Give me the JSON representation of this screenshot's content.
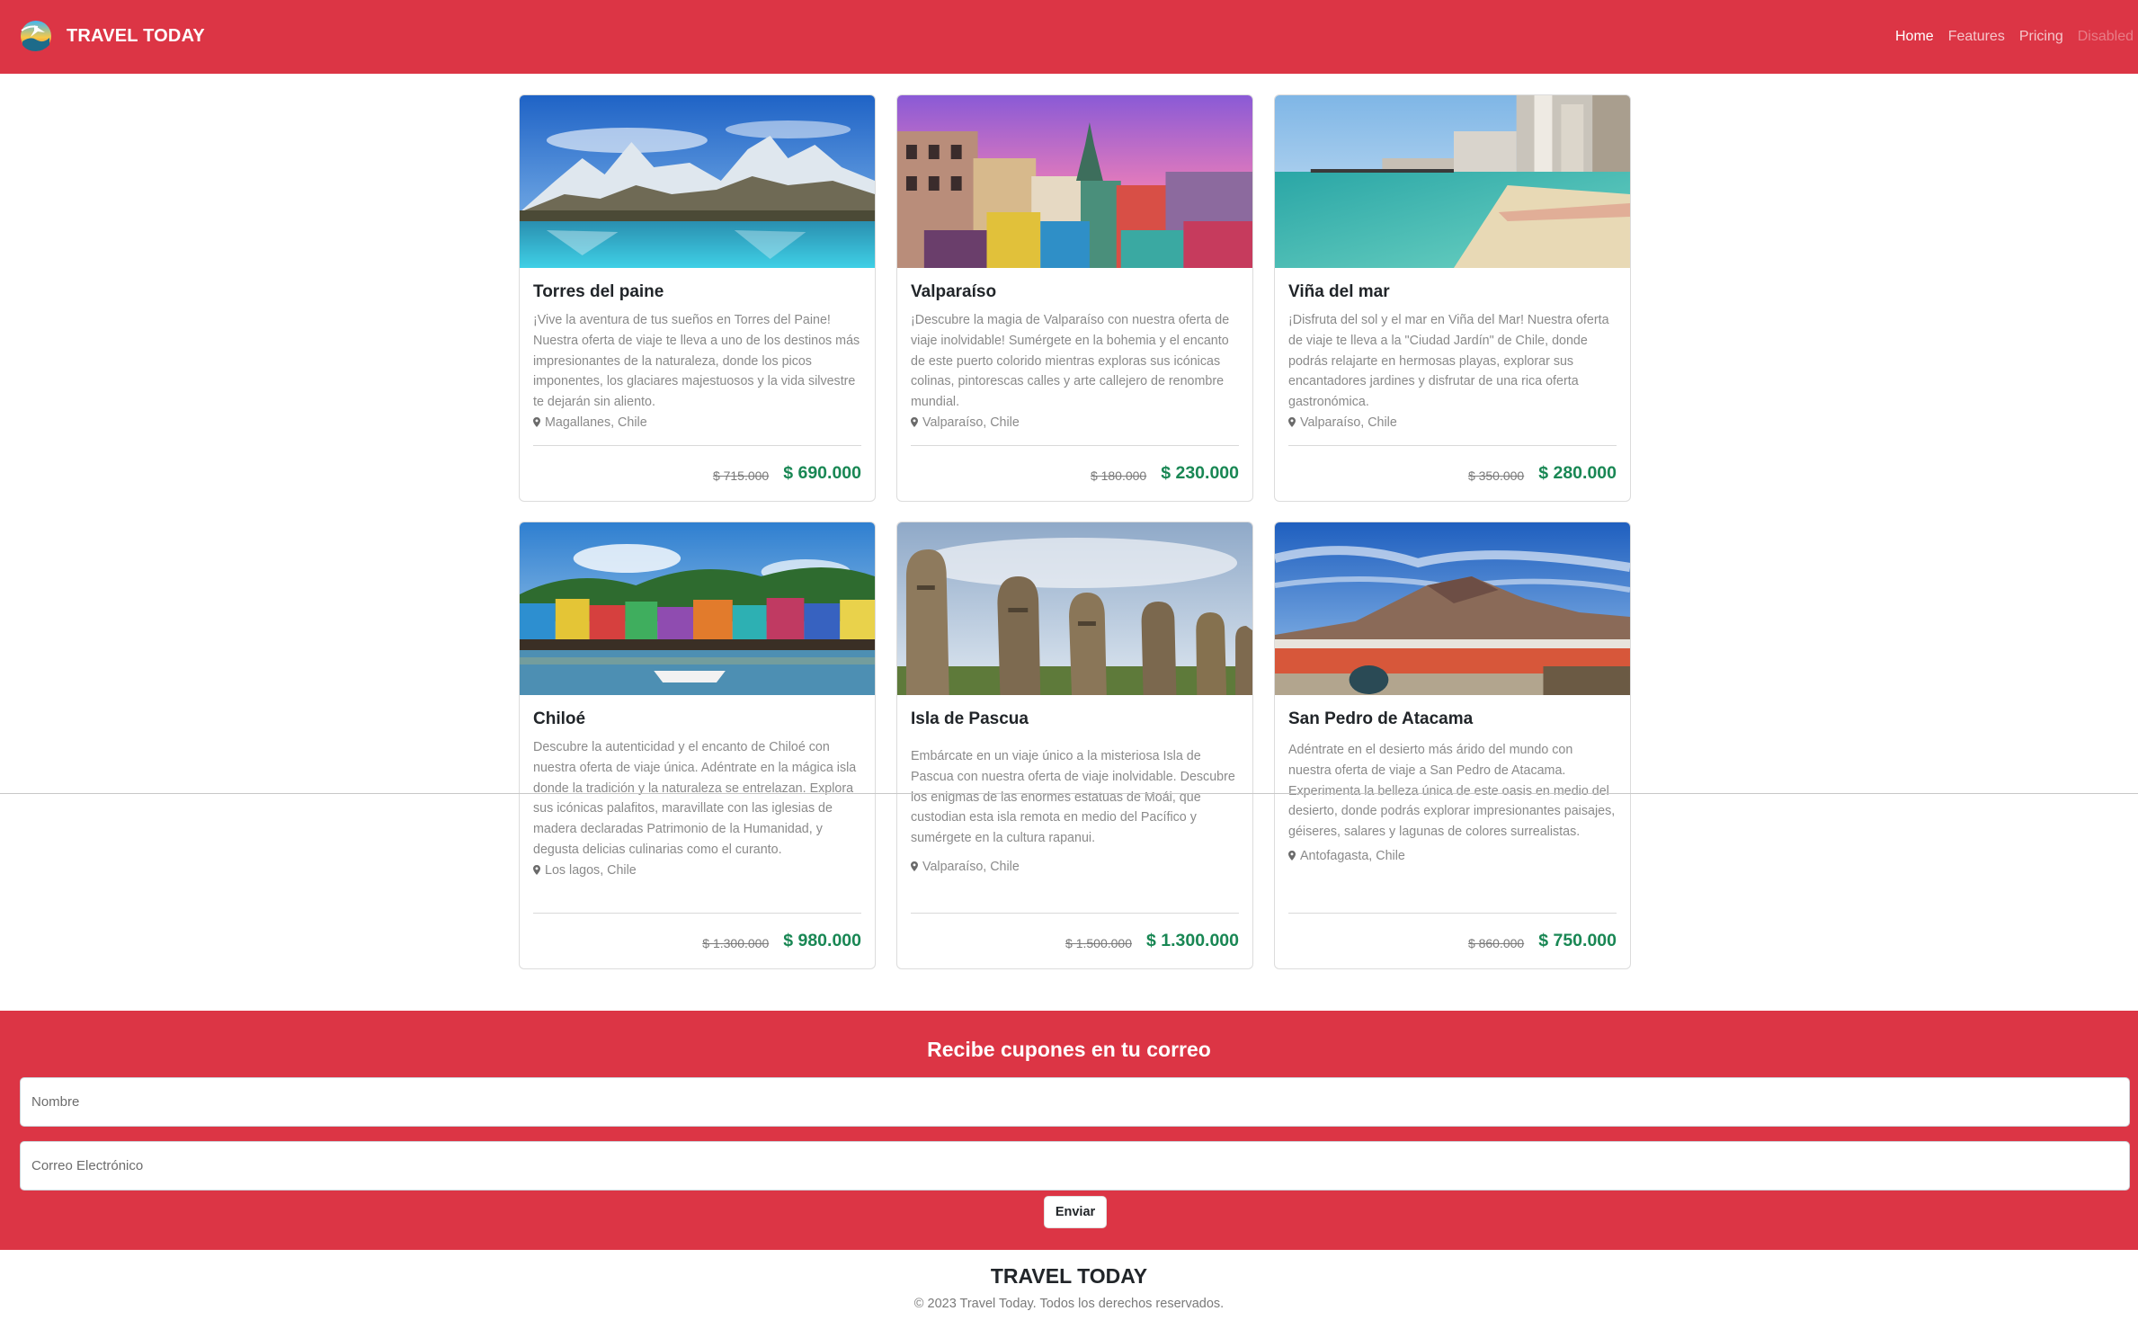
{
  "brand": {
    "name": "TRAVEL TODAY"
  },
  "nav": {
    "items": [
      {
        "label": "Home",
        "state": "active"
      },
      {
        "label": "Features",
        "state": "normal"
      },
      {
        "label": "Pricing",
        "state": "normal"
      },
      {
        "label": "Disabled",
        "state": "disabled"
      }
    ]
  },
  "cards": [
    {
      "title": "Torres del paine",
      "text": "¡Vive la aventura de tus sueños en Torres del Paine! Nuestra oferta de viaje te lleva a uno de los destinos más impresionantes de la naturaleza, donde los picos imponentes, los glaciares majestuosos y la vida silvestre te dejarán sin aliento.",
      "location": "Magallanes, Chile",
      "old_price": "$ 715.000",
      "price": "$ 690.000",
      "image": "mountain-lake"
    },
    {
      "title": "Valparaíso",
      "text": "¡Descubre la magia de Valparaíso con nuestra oferta de viaje inolvidable! Sumérgete en la bohemia y el encanto de este puerto colorido mientras exploras sus icónicas colinas, pintorescas calles y arte callejero de renombre mundial.",
      "location": "Valparaíso, Chile",
      "old_price": "$ 180.000",
      "price": "$ 230.000",
      "image": "colorful-city"
    },
    {
      "title": "Viña del mar",
      "text": "¡Disfruta del sol y el mar en Viña del Mar! Nuestra oferta de viaje te lleva a la \"Ciudad Jardín\" de Chile, donde podrás relajarte en hermosas playas, explorar sus encantadores jardines y disfrutar de una rica oferta gastronómica.",
      "location": "Valparaíso, Chile",
      "old_price": "$ 350.000",
      "price": "$ 280.000",
      "image": "beach"
    },
    {
      "title": "Chiloé",
      "text": "Descubre la autenticidad y el encanto de Chiloé con nuestra oferta de viaje única. Adéntrate en la mágica isla donde la tradición y la naturaleza se entrelazan. Explora sus icónicas palafitos, maravillate con las iglesias de madera declaradas Patrimonio de la Humanidad, y degusta delicias culinarias como el curanto.",
      "location": "Los lagos, Chile",
      "old_price": "$ 1.300.000",
      "price": "$ 980.000",
      "image": "stilt-houses"
    },
    {
      "title": "Isla de Pascua",
      "text": "Embárcate en un viaje único a la misteriosa Isla de Pascua con nuestra oferta de viaje inolvidable. Descubre los enigmas de las enormes estatuas de Moái, que custodian esta isla remota en medio del Pacífico y sumérgete en la cultura rapanui.",
      "location": "Valparaíso, Chile",
      "old_price": "$ 1.500.000",
      "price": "$ 1.300.000",
      "image": "moai"
    },
    {
      "title": "San Pedro de Atacama",
      "text": "Adéntrate en el desierto más árido del mundo con nuestra oferta de viaje a San Pedro de Atacama. Experimenta la belleza única de este oasis en medio del desierto, donde podrás explorar impresionantes paisajes, géiseres, salares y lagunas de colores surrealistas.",
      "location": "Antofagasta, Chile",
      "old_price": "$ 860.000",
      "price": "$ 750.000",
      "image": "desert-lagoon"
    }
  ],
  "newsletter": {
    "title": "Recibe cupones en tu correo",
    "name_placeholder": "Nombre",
    "email_placeholder": "Correo Electrónico",
    "submit_label": "Enviar"
  },
  "footer": {
    "brand": "TRAVEL TODAY",
    "copyright": "© 2023 Travel Today. Todos los derechos reservados."
  },
  "colors": {
    "primary": "#dc3545",
    "price": "#198754",
    "muted_text": "#8a8a8a"
  }
}
